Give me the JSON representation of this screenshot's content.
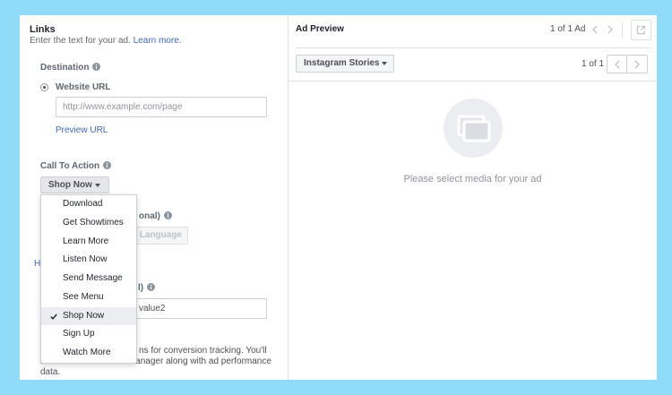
{
  "colors": {
    "page_background": "#8fdbf8",
    "link": "#4267b2",
    "divider": "#dddfe2",
    "muted_text": "#90949c"
  },
  "links": {
    "title": "Links",
    "subtitle": "Enter the text for your ad.",
    "learn_more_link": "Learn more.",
    "destination": {
      "label": "Destination",
      "option": {
        "label": "Website URL",
        "checked": true
      },
      "website_url_placeholder": "http://www.example.com/page",
      "preview_link": "Preview URL"
    },
    "call_to_action": {
      "label": "Call To Action",
      "selected": "Shop Now",
      "menu_open": true,
      "options": [
        {
          "label": "Download",
          "selected": false
        },
        {
          "label": "Get Showtimes",
          "selected": false
        },
        {
          "label": "Learn More",
          "selected": false
        },
        {
          "label": "Listen Now",
          "selected": false
        },
        {
          "label": "Send Message",
          "selected": false
        },
        {
          "label": "See Menu",
          "selected": false
        },
        {
          "label": "Shop Now",
          "selected": true
        },
        {
          "label": "Sign Up",
          "selected": false
        },
        {
          "label": "Watch More",
          "selected": false
        }
      ]
    },
    "partially_hidden": {
      "label_tail_1": "onal)",
      "language_button": "Language",
      "link_head": "H",
      "label_tail_2": "l)",
      "parameters_value_tail": "value2",
      "note_lines": [
        "ns for conversion tracking. You'll",
        "see the results in Ads Manager along with ad performance",
        "data."
      ]
    }
  },
  "ad_preview": {
    "title": "Ad Preview",
    "ad_counter": "1 of 1 Ad",
    "placement": "Instagram Stories",
    "placement_counter": "1 of 1",
    "empty_state_message": "Please select media for your ad"
  }
}
